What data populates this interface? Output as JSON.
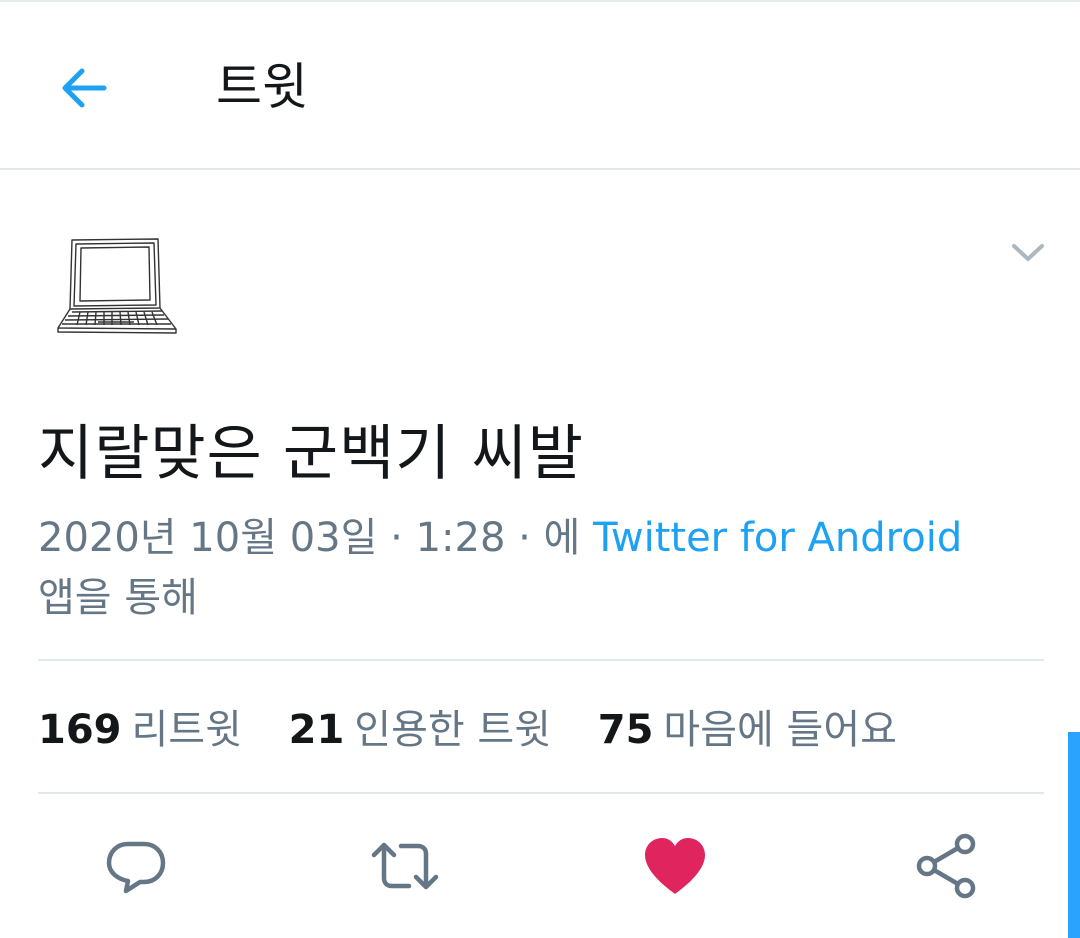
{
  "header": {
    "title": "트윗",
    "back_icon": "arrow-left-icon"
  },
  "tweet": {
    "avatar_icon": "laptop-sketch-icon",
    "text": "지랄맞은 군백기 씨발",
    "timestamp": "2020년 10월 03일 · 1:28 · 에",
    "via_client": "Twitter for Android",
    "via_suffix": "앱을 통해"
  },
  "stats": {
    "retweets_count": "169",
    "retweets_label": "리트윗",
    "quotes_count": "21",
    "quotes_label": "인용한 트윗",
    "likes_count": "75",
    "likes_label": "마음에 들어요"
  },
  "actions": [
    "reply-icon",
    "retweet-icon",
    "heart-icon",
    "share-icon"
  ],
  "colors": {
    "accent": "#1da1f2",
    "like": "#e0245e",
    "secondary_text": "#657786",
    "icon_gray": "#657786",
    "divider": "#e1e8ed"
  }
}
